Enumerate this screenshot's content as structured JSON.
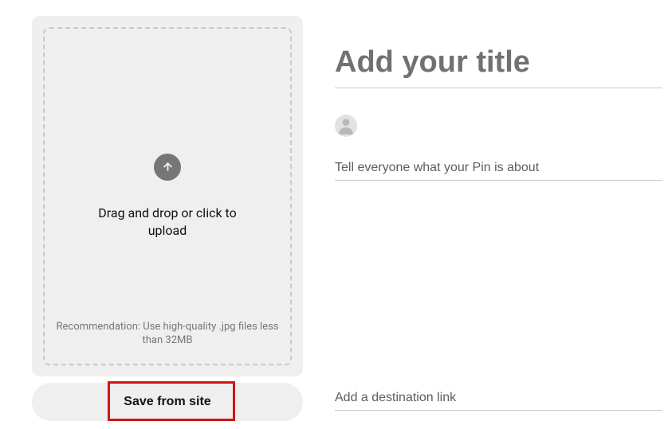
{
  "upload": {
    "prompt": "Drag and drop or click to upload",
    "hint": "Recommendation: Use high-quality .jpg files less than 32MB"
  },
  "save_from_site_label": "Save from site",
  "form": {
    "title_placeholder": "Add your title",
    "title_value": "",
    "desc_placeholder": "Tell everyone what your Pin is about",
    "desc_value": "",
    "link_placeholder": "Add a destination link",
    "link_value": ""
  },
  "icons": {
    "upload": "upload-arrow",
    "avatar": "user"
  }
}
